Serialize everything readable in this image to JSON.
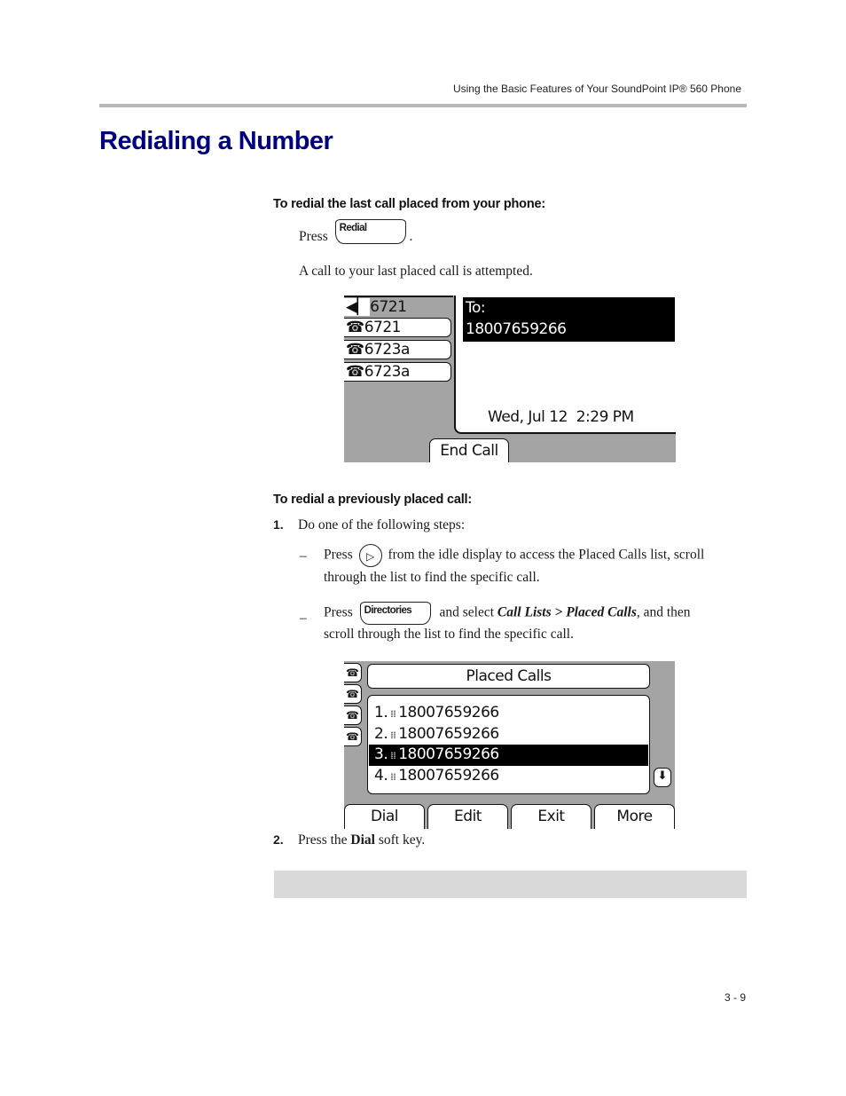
{
  "running_header": "Using the Basic Features of Your SoundPoint IP® 560 Phone",
  "page_title": "Redialing a Number",
  "section1": {
    "heading": "To redial the last call placed from your phone:",
    "press_word": "Press",
    "key_label": "Redial",
    "after_key": ".",
    "result_text": "A call to your last placed call is attempted."
  },
  "screen1": {
    "lines": [
      {
        "icon": "speaker-icon",
        "label": "6721",
        "active": true
      },
      {
        "icon": "handset-icon",
        "label": "6721"
      },
      {
        "icon": "handset-icon",
        "label": "6723a"
      },
      {
        "icon": "handset-icon",
        "label": "6723a"
      }
    ],
    "to_label": "To:",
    "number": "18007659266",
    "datetime": "Wed, Jul 12  2:29 PM",
    "softkeys": [
      "End Call"
    ]
  },
  "section2": {
    "heading": "To redial a previously placed call:",
    "steps": [
      {
        "num": "1.",
        "text": "Do one of the following steps:",
        "bullets": [
          {
            "dash": "–",
            "press": "Press",
            "key_icon": "right-arrow-key",
            "text_after": "from the idle display to access the Placed Calls list, scroll",
            "text_line2": "through the list to find the specific call."
          },
          {
            "dash": "–",
            "press": "Press",
            "key_label": "Directories",
            "text_pre": "and select ",
            "menu_path": "Call Lists > Placed Calls",
            "text_post": ", and then",
            "text_line2": "scroll through the list to find the specific call."
          }
        ]
      },
      {
        "num": "2.",
        "text_pre": "Press the ",
        "bold": "Dial",
        "text_post": " soft key."
      }
    ]
  },
  "screen2": {
    "title": "Placed Calls",
    "items": [
      {
        "index": "1.",
        "number": "18007659266",
        "selected": false
      },
      {
        "index": "2.",
        "number": "18007659266",
        "selected": false
      },
      {
        "index": "3.",
        "number": "18007659266",
        "selected": true
      },
      {
        "index": "4.",
        "number": "18007659266",
        "selected": false
      }
    ],
    "softkeys": [
      "Dial",
      "Edit",
      "Exit",
      "More"
    ]
  },
  "page_number": "3 - 9"
}
